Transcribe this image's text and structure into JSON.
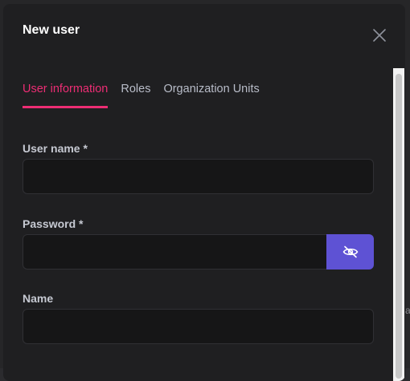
{
  "modal": {
    "title": "New user"
  },
  "tabs": [
    {
      "label": "User information",
      "active": true
    },
    {
      "label": "Roles",
      "active": false
    },
    {
      "label": "Organization Units",
      "active": false
    }
  ],
  "form": {
    "username": {
      "label": "User name *",
      "value": ""
    },
    "password": {
      "label": "Password *",
      "value": ""
    },
    "name": {
      "label": "Name",
      "value": ""
    }
  },
  "icons": {
    "close": "close-icon",
    "password_toggle": "eye-slash-icon"
  },
  "colors": {
    "accent": "#ed2d74",
    "primary_button": "#5e52d4",
    "modal_bg": "#1f1f21",
    "input_bg": "#161617"
  }
}
